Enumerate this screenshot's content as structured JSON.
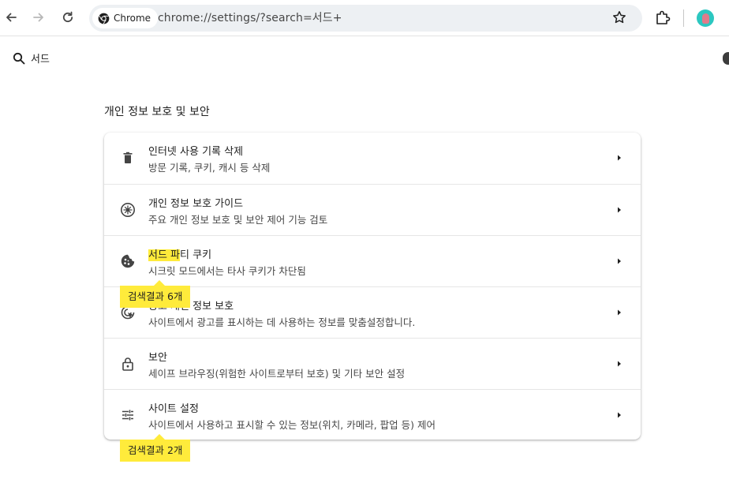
{
  "browser": {
    "chip_label": "Chrome",
    "url": "chrome://settings/?search=서드+"
  },
  "search": {
    "query": "서드"
  },
  "section": {
    "title": "개인 정보 보호 및 보안"
  },
  "items": [
    {
      "title": "인터넷 사용 기록 삭제",
      "subtitle": "방문 기록, 쿠키, 캐시 등 삭제",
      "icon": "trash-icon"
    },
    {
      "title": "개인 정보 보호 가이드",
      "subtitle": "주요 개인 정보 보호 및 보안 제어 기능 검토",
      "icon": "compass-icon"
    },
    {
      "title_highlight": "서드 파",
      "title_rest": "티 쿠키",
      "subtitle": "시크릿 모드에서는 타사 쿠키가 차단됨",
      "icon": "cookie-icon"
    },
    {
      "title_prefix": "광고 개인 ",
      "title": "정보 보호",
      "subtitle": "사이트에서 광고를 표시하는 데 사용하는 정보를 맞춤설정합니다.",
      "icon": "ad-privacy-icon"
    },
    {
      "title": "보안",
      "subtitle": "세이프 브라우징(위험한 사이트로부터 보호) 및 기타 보안 설정",
      "icon": "lock-icon"
    },
    {
      "title": "사이트 설정",
      "subtitle": "사이트에서 사용하고 표시할 수 있는 정보(위치, 카메라, 팝업 등) 제어",
      "icon": "sliders-icon"
    }
  ],
  "bubbles": {
    "first": "검색결과 6개",
    "second": "검색결과 2개"
  },
  "colors": {
    "highlight": "#ffeb3b",
    "omnibox": "#edf0f3"
  }
}
